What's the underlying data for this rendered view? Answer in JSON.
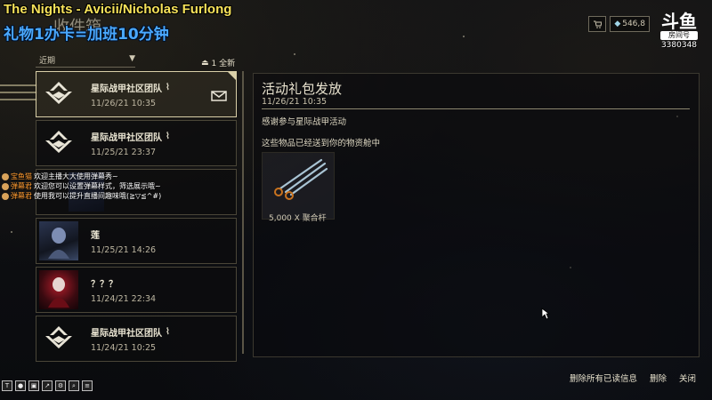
{
  "overlay": {
    "song_title": "The Nights - Avicii/Nicholas Furlong",
    "caption": "礼物1办卡=加班10分钟",
    "logo_main": "斗鱼",
    "logo_sub": "房间号",
    "room_number": "3380348",
    "balance": "546,8"
  },
  "inbox": {
    "title": "收件箱",
    "filter_value": "近期",
    "unread_count": "1 全新",
    "items": [
      {
        "sender": "星际战甲社区团队",
        "date": "11/26/21 10:35",
        "has_attachment": true,
        "selected": true
      },
      {
        "sender": "星际战甲社区团队",
        "date": "11/25/21 23:37",
        "has_attachment": true
      },
      {
        "sender": "",
        "date": ""
      },
      {
        "sender": "莲",
        "date": "11/25/21 14:26"
      },
      {
        "sender": "？？？",
        "date": "11/24/21 22:34"
      },
      {
        "sender": "星际战甲社区团队",
        "date": "11/24/21 10:25",
        "has_attachment": true
      }
    ]
  },
  "chat": [
    {
      "user": "宝鱼猫",
      "text": "欢迎主播大大使用弹幕秀~"
    },
    {
      "user": "弹幕君",
      "text": "欢迎您可以设置弹幕样式，筛选展示哦~"
    },
    {
      "user": "弹幕君",
      "text": "使用我可以提升直播间趣味哦(≧▽≦^#)"
    }
  ],
  "message": {
    "title": "活动礼包发放",
    "date": "11/26/21 10:35",
    "body": "感谢参与星际战甲活动",
    "note": "这些物品已经送到你的物资舱中",
    "reward_quantity": "5,000 X 聚合杆"
  },
  "actions": {
    "delete_all_read": "删除所有已读信息",
    "delete": "删除",
    "close": "关闭"
  },
  "colors": {
    "gold_border": "#d9cfa8",
    "song_title": "#f6e25a",
    "caption": "#4aa9ff"
  }
}
